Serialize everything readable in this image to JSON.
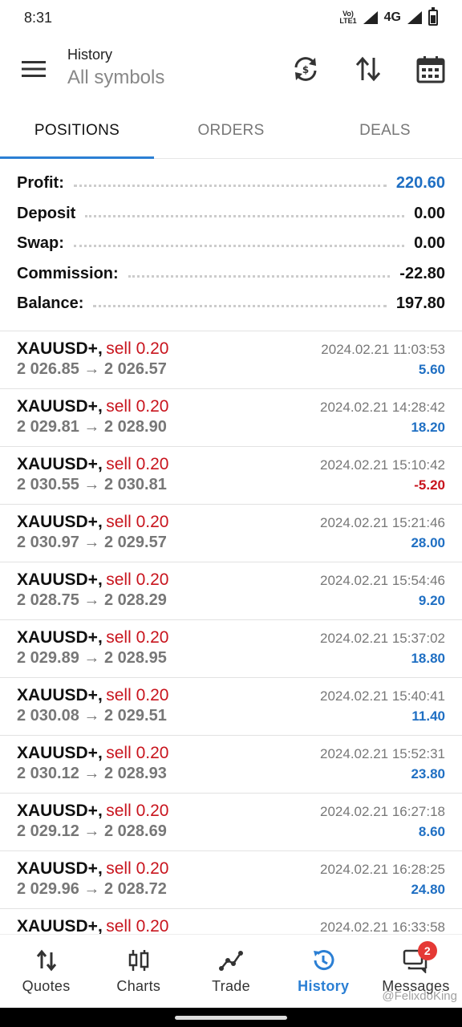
{
  "status_bar": {
    "time": "8:31",
    "volte": "VoLTE1",
    "network": "4G"
  },
  "header": {
    "title": "History",
    "subtitle": "All symbols"
  },
  "tabs": [
    {
      "label": "POSITIONS",
      "active": true
    },
    {
      "label": "ORDERS",
      "active": false
    },
    {
      "label": "DEALS",
      "active": false
    }
  ],
  "summary": {
    "profit": {
      "label": "Profit:",
      "value": "220.60"
    },
    "deposit": {
      "label": "Deposit",
      "value": "0.00"
    },
    "swap": {
      "label": "Swap:",
      "value": "0.00"
    },
    "commission": {
      "label": "Commission:",
      "value": "-22.80"
    },
    "balance": {
      "label": "Balance:",
      "value": "197.80"
    }
  },
  "deals": [
    {
      "symbol": "XAUUSD+,",
      "side": "sell 0.20",
      "time": "2024.02.21 11:03:53",
      "prices": "2 026.85 → 2 026.57",
      "profit": "5.60"
    },
    {
      "symbol": "XAUUSD+,",
      "side": "sell 0.20",
      "time": "2024.02.21 14:28:42",
      "prices": "2 029.81 → 2 028.90",
      "profit": "18.20"
    },
    {
      "symbol": "XAUUSD+,",
      "side": "sell 0.20",
      "time": "2024.02.21 15:10:42",
      "prices": "2 030.55 → 2 030.81",
      "profit": "-5.20"
    },
    {
      "symbol": "XAUUSD+,",
      "side": "sell 0.20",
      "time": "2024.02.21 15:21:46",
      "prices": "2 030.97 → 2 029.57",
      "profit": "28.00"
    },
    {
      "symbol": "XAUUSD+,",
      "side": "sell 0.20",
      "time": "2024.02.21 15:54:46",
      "prices": "2 028.75 → 2 028.29",
      "profit": "9.20"
    },
    {
      "symbol": "XAUUSD+,",
      "side": "sell 0.20",
      "time": "2024.02.21 15:37:02",
      "prices": "2 029.89 → 2 028.95",
      "profit": "18.80"
    },
    {
      "symbol": "XAUUSD+,",
      "side": "sell 0.20",
      "time": "2024.02.21 15:40:41",
      "prices": "2 030.08 → 2 029.51",
      "profit": "11.40"
    },
    {
      "symbol": "XAUUSD+,",
      "side": "sell 0.20",
      "time": "2024.02.21 15:52:31",
      "prices": "2 030.12 → 2 028.93",
      "profit": "23.80"
    },
    {
      "symbol": "XAUUSD+,",
      "side": "sell 0.20",
      "time": "2024.02.21 16:27:18",
      "prices": "2 029.12 → 2 028.69",
      "profit": "8.60"
    },
    {
      "symbol": "XAUUSD+,",
      "side": "sell 0.20",
      "time": "2024.02.21 16:28:25",
      "prices": "2 029.96 → 2 028.72",
      "profit": "24.80"
    },
    {
      "symbol": "XAUUSD+,",
      "side": "sell 0.20",
      "time": "2024.02.21 16:33:58",
      "prices": "",
      "profit": ""
    }
  ],
  "bottom_nav": [
    {
      "label": "Quotes",
      "icon": "quotes-icon"
    },
    {
      "label": "Charts",
      "icon": "charts-icon"
    },
    {
      "label": "Trade",
      "icon": "trade-icon"
    },
    {
      "label": "History",
      "icon": "history-icon",
      "active": true
    },
    {
      "label": "Messages",
      "icon": "messages-icon",
      "badge": "2"
    }
  ],
  "watermark": "@FelixdoKing",
  "colors": {
    "accent": "#2b7fd4",
    "profit_blue": "#1f6fc3",
    "sell_red": "#c8141d"
  }
}
